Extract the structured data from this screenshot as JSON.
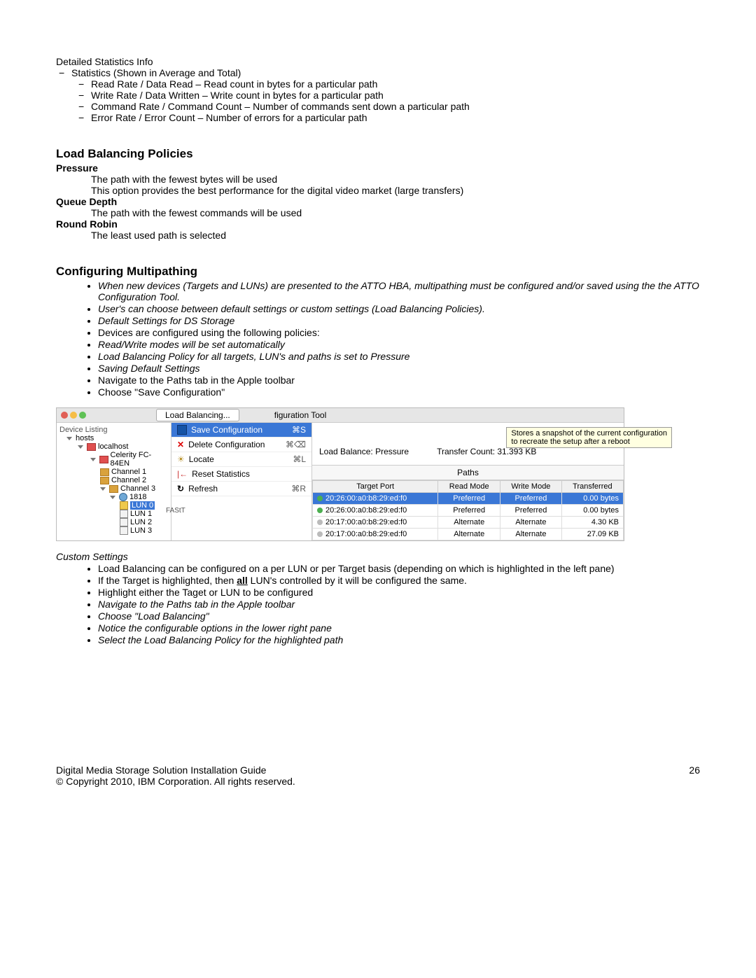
{
  "stats": {
    "title": "Detailed Statistics Info",
    "line1": "Statistics (Shown in Average and Total)",
    "items": [
      "Read Rate / Data Read – Read count in bytes for a particular path",
      "Write Rate / Data Written – Write count in bytes for a particular path",
      "Command Rate / Command Count – Number of commands sent down a particular path",
      "Error Rate / Error Count – Number of errors for a particular path"
    ]
  },
  "policies": {
    "heading": "Load Balancing Policies",
    "pressure_label": "Pressure",
    "pressure_d1": "The path with the fewest bytes will be used",
    "pressure_d2": "This option provides the best performance for the digital video market (large transfers)",
    "queue_label": "Queue Depth",
    "queue_d1": "The path with the fewest commands will be used",
    "round_label": "Round Robin",
    "round_d1": "The least used path is selected"
  },
  "config": {
    "heading": "Configuring Multipathing",
    "items": [
      {
        "t": "When new devices (Targets and LUNs) are presented to the ATTO HBA, multipathing must be configured and/or saved using the the ATTO Configuration Tool.",
        "i": true
      },
      {
        "t": "User's can choose between default settings or custom settings (Load Balancing Policies).",
        "i": true
      },
      {
        "t": "Default Settings for DS Storage",
        "i": true
      },
      {
        "t": "Devices are configured using the following policies:",
        "i": false
      },
      {
        "t": "Read/Write modes will be set automatically",
        "i": true
      },
      {
        "t": "Load Balancing Policy for all targets, LUN's and paths is set to Pressure",
        "i": true
      },
      {
        "t": "Saving Default Settings",
        "i": true
      },
      {
        "t": "Navigate to the Paths tab in the Apple toolbar",
        "i": false
      },
      {
        "t": "Choose \"Save Configuration\"",
        "i": false
      }
    ]
  },
  "shot": {
    "segment": "Load Balancing...",
    "title_right": "figuration Tool",
    "tooltip_l1": "Stores a snapshot of the current configuration",
    "tooltip_l2": "to recreate the setup after a reboot",
    "sidebar_title": "Device Listing",
    "tree": {
      "hosts": "hosts",
      "local": "localhost",
      "card": "Celerity FC-84EN",
      "ch1": "Channel 1",
      "ch2": "Channel 2",
      "ch3": "Channel 3",
      "tgt": "1818",
      "lun0": "LUN 0",
      "lun1": "LUN 1",
      "lun2": "LUN 2",
      "lun3": "LUN 3"
    },
    "fast": "FAStT",
    "menu": {
      "save": "Save Configuration",
      "save_sc": "⌘S",
      "del": "Delete Configuration",
      "del_sc": "⌘⌫",
      "locate": "Locate",
      "locate_sc": "⌘L",
      "reset": "Reset Statistics",
      "refresh": "Refresh",
      "refresh_sc": "⌘R"
    },
    "info": {
      "lb_label": "Load Balance:",
      "lb_val": "Pressure",
      "tc_label": "Transfer Count:",
      "tc_val": "31.393 KB"
    },
    "paths_header": "Paths",
    "table": {
      "cols": [
        "Target Port",
        "Read Mode",
        "Write Mode",
        "Transferred"
      ],
      "rows": [
        {
          "s": "green",
          "tp": "20:26:00:a0:b8:29:ed:f0",
          "rm": "Preferred",
          "wm": "Preferred",
          "tr": "0.00 bytes",
          "sel": true
        },
        {
          "s": "green",
          "tp": "20:26:00:a0:b8:29:ed:f0",
          "rm": "Preferred",
          "wm": "Preferred",
          "tr": "0.00 bytes",
          "sel": false
        },
        {
          "s": "gray",
          "tp": "20:17:00:a0:b8:29:ed:f0",
          "rm": "Alternate",
          "wm": "Alternate",
          "tr": "4.30 KB",
          "sel": false
        },
        {
          "s": "gray",
          "tp": "20:17:00:a0:b8:29:ed:f0",
          "rm": "Alternate",
          "wm": "Alternate",
          "tr": "27.09 KB",
          "sel": false
        }
      ]
    }
  },
  "custom": {
    "heading": "Custom Settings",
    "item1_pre": "Load Balancing can be configured on a per LUN or per Target basis (depending on which is highlighted in the left pane)",
    "item2_pre": "If the Target is highlighted, then ",
    "item2_all": "all",
    "item2_post": " LUN's controlled by it will be configured the same.",
    "items_rest": [
      {
        "t": "Highlight either the Taget or LUN to be configured",
        "i": false
      },
      {
        "t": "Navigate to the Paths tab in the Apple toolbar",
        "i": true
      },
      {
        "t": "Choose \"Load Balancing\"",
        "i": true
      },
      {
        "t": "Notice the configurable options in the lower right pane",
        "i": true
      },
      {
        "t": "Select the Load Balancing Policy for the highlighted path",
        "i": true
      }
    ]
  },
  "footer": {
    "l1": "Digital Media Storage Solution Installation Guide",
    "l2": "© Copyright 2010, IBM Corporation. All rights reserved.",
    "page": "26"
  }
}
